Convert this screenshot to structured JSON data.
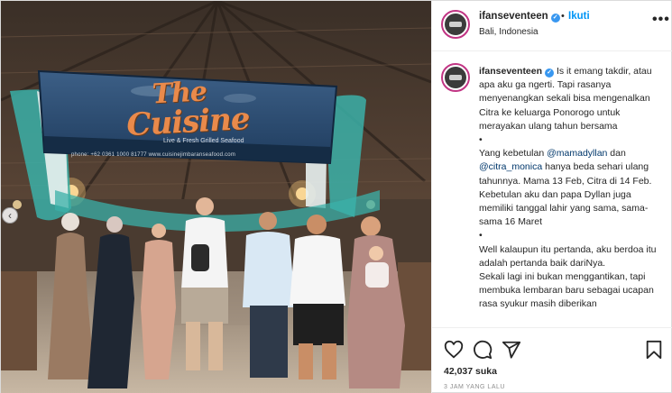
{
  "post": {
    "username": "ifanseventeen",
    "follow_separator": "•",
    "follow_label": "Ikuti",
    "location": "Bali, Indonesia",
    "more_label": "•••"
  },
  "photo": {
    "sign_title_line1": "The",
    "sign_title_line2": "Cuisine",
    "sign_subtitle": "Live & Fresh Grilled Seafood",
    "sign_contacts": "phone: +62 0361  1000 81777   www.cuisinejimbaranseafood.com",
    "carousel_prev": "‹"
  },
  "caption": {
    "username": "ifanseventeen",
    "p1": "Is it emang takdir, atau apa aku ga ngerti. Tapi rasanya menyenangkan sekali bisa mengenalkan Citra ke keluarga Ponorogo untuk merayakan ulang tahun bersama",
    "bullet1": "•",
    "p2_a": "Yang kebetulan ",
    "mention1": "@mamadyllan",
    "p2_b": " dan ",
    "mention2": "@citra_monica",
    "p2_c": " hanya beda sehari ulang tahunnya. Mama 13 Feb, Citra di 14 Feb. Kebetulan aku dan papa Dyllan juga memiliki tanggal lahir yang sama, sama-sama 16 Maret",
    "bullet2": "•",
    "p3": "Well kalaupun itu pertanda, aku berdoa itu adalah pertanda baik dariNya.",
    "p4": "Sekali lagi ini bukan menggantikan, tapi membuka lembaran baru sebagai ucapan rasa syukur masih diberikan"
  },
  "actions": {
    "icons": [
      "heart-icon",
      "comment-icon",
      "share-icon",
      "bookmark-icon"
    ],
    "likes": "42,037 suka",
    "time": "3 JAM YANG LALU"
  },
  "colors": {
    "link": "#0095f6",
    "mention": "#00376b",
    "verified": "#3897f0",
    "text": "#262626",
    "muted": "#8e8e8e",
    "border": "#dbdbdb"
  }
}
